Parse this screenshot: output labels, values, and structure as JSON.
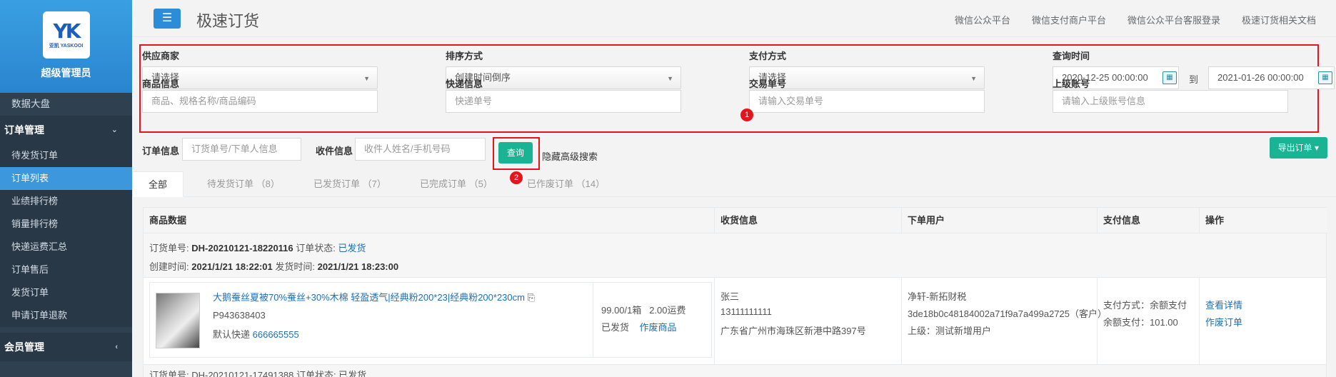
{
  "sidebar": {
    "logo_mark": "YK",
    "logo_sub": "亚凯 YASKOOI",
    "user": "超级管理员",
    "items_top": [
      "数据大盘"
    ],
    "group_order": "订单管理",
    "order_items": [
      "待发货订单",
      "订单列表",
      "业绩排行榜",
      "销量排行榜",
      "快递运费汇总",
      "订单售后",
      "发货订单",
      "申请订单退款"
    ],
    "active_item": "订单列表",
    "group_member": "会员管理"
  },
  "header": {
    "menu_icon": "☰",
    "title": "极速订货",
    "links": [
      "微信公众平台",
      "微信支付商户平台",
      "微信公众平台客服登录",
      "极速订货相关文档"
    ]
  },
  "filters": {
    "supplier_label": "供应商家",
    "supplier_value": "请选择",
    "sort_label": "排序方式",
    "sort_value": "创建时间倒序",
    "pay_label": "支付方式",
    "pay_value": "请选择",
    "time_label": "查询时间",
    "time_start": "2020-12-25 00:00:00",
    "time_to": "到",
    "time_end": "2021-01-26 00:00:00",
    "goods_label": "商品信息",
    "goods_placeholder": "商品、规格名称/商品编码",
    "express_label": "快递信息",
    "express_placeholder": "快递单号",
    "trade_label": "交易单号",
    "trade_placeholder": "请输入交易单号",
    "parent_label": "上级账号",
    "parent_placeholder": "请输入上级账号信息",
    "badge1": "1"
  },
  "search": {
    "order_label": "订单信息",
    "order_placeholder": "订货单号/下单人信息",
    "receiver_label": "收件信息",
    "receiver_placeholder": "收件人姓名/手机号码",
    "query_button": "查询",
    "badge2": "2",
    "hide_advanced": "隐藏高级搜索",
    "export_button": "导出订单 ▾"
  },
  "tabs": [
    "全部",
    "待发货订单 （8）",
    "已发货订单 （7）",
    "已完成订单 （5）",
    "已作废订单 （14）"
  ],
  "table": {
    "headers": [
      "商品数据",
      "收货信息",
      "下单用户",
      "支付信息",
      "操作"
    ],
    "order": {
      "no_label": "订货单号:",
      "no": "DH-20210121-18220116",
      "status_label": "订单状态:",
      "status": "已发货",
      "created_label": "创建时间:",
      "created": "2021/1/21 18:22:01",
      "shipped_label": "发货时间:",
      "shipped": "2021/1/21 18:23:00",
      "product_title": "大鹅蚕丝夏被70%蚕丝+30%木棉 轻盈透气|经典粉200*23|经典粉200*230cm",
      "product_code": "P943638403",
      "express_label": "默认快递",
      "express_no": "666665555",
      "price": "99.00/1箱",
      "freight": "2.00运费",
      "ship_state": "已发货",
      "void_goods": "作废商品",
      "receiver_name": "张三",
      "receiver_phone": "13111111111",
      "receiver_addr": "广东省广州市海珠区新港中路397号",
      "user_name": "净轩-新拓财税",
      "user_id": "3de18b0c48184002a71f9a7a499a2725（客户）",
      "user_parent": "上级：测试新增用户",
      "pay_method": "支付方式：余额支付",
      "pay_amount": "余额支付：101.00",
      "op_detail": "查看详情",
      "op_void": "作废订单"
    },
    "next_order_no": "订货单号:  DH-20210121-17491388 订单状态:  已发货"
  }
}
